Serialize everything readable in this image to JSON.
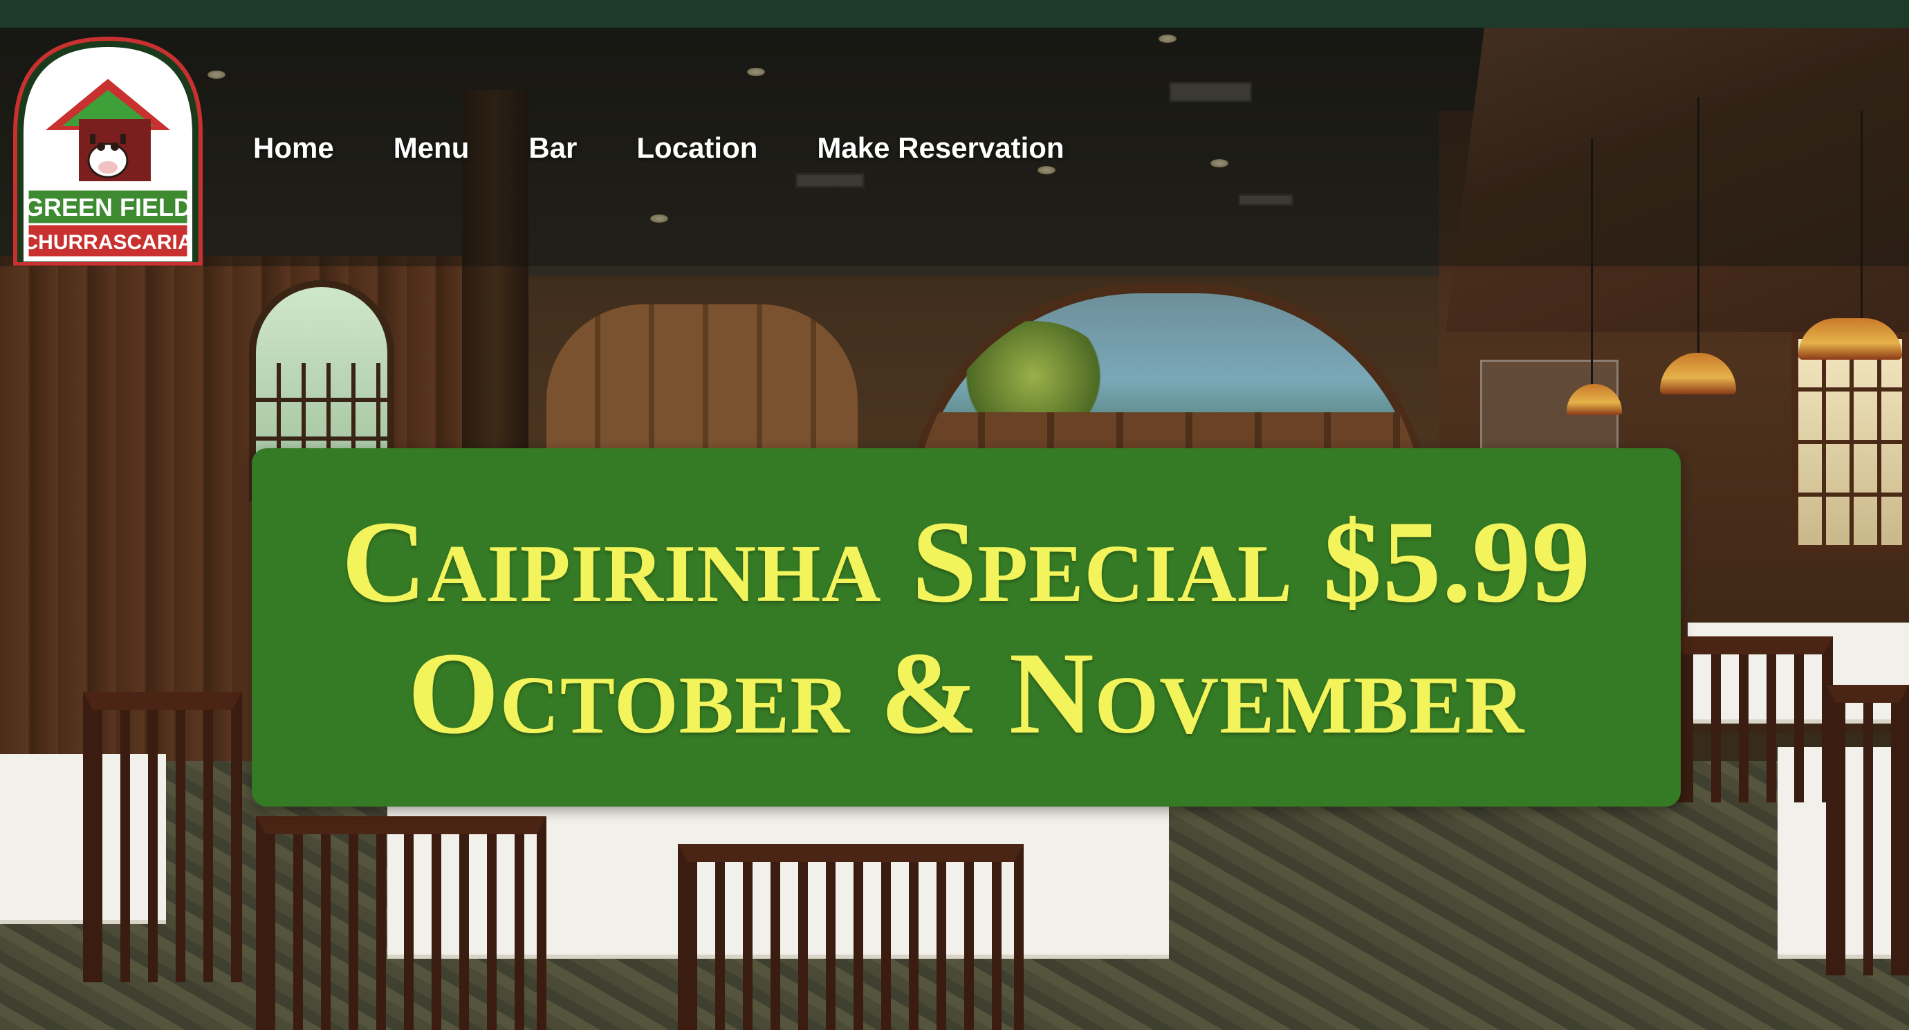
{
  "logo": {
    "line1": "GREEN FIELD",
    "line2": "CHURRASCARIA",
    "icon": "cow-house-logo-icon",
    "colors": {
      "roof": "#c8312f",
      "field": "#2f7a2e",
      "text_bg": "#3d8a30",
      "text2_bg": "#c8312f"
    }
  },
  "nav": {
    "items": [
      {
        "label": "Home"
      },
      {
        "label": "Menu"
      },
      {
        "label": "Bar"
      },
      {
        "label": "Location"
      },
      {
        "label": "Make Reservation"
      }
    ]
  },
  "promo": {
    "line1": "Caipirinha Special $5.99",
    "line2": "October & November",
    "bg_color": "#357a24",
    "text_color": "#f3f35c"
  },
  "colors": {
    "top_strip": "#1e3a2a"
  }
}
